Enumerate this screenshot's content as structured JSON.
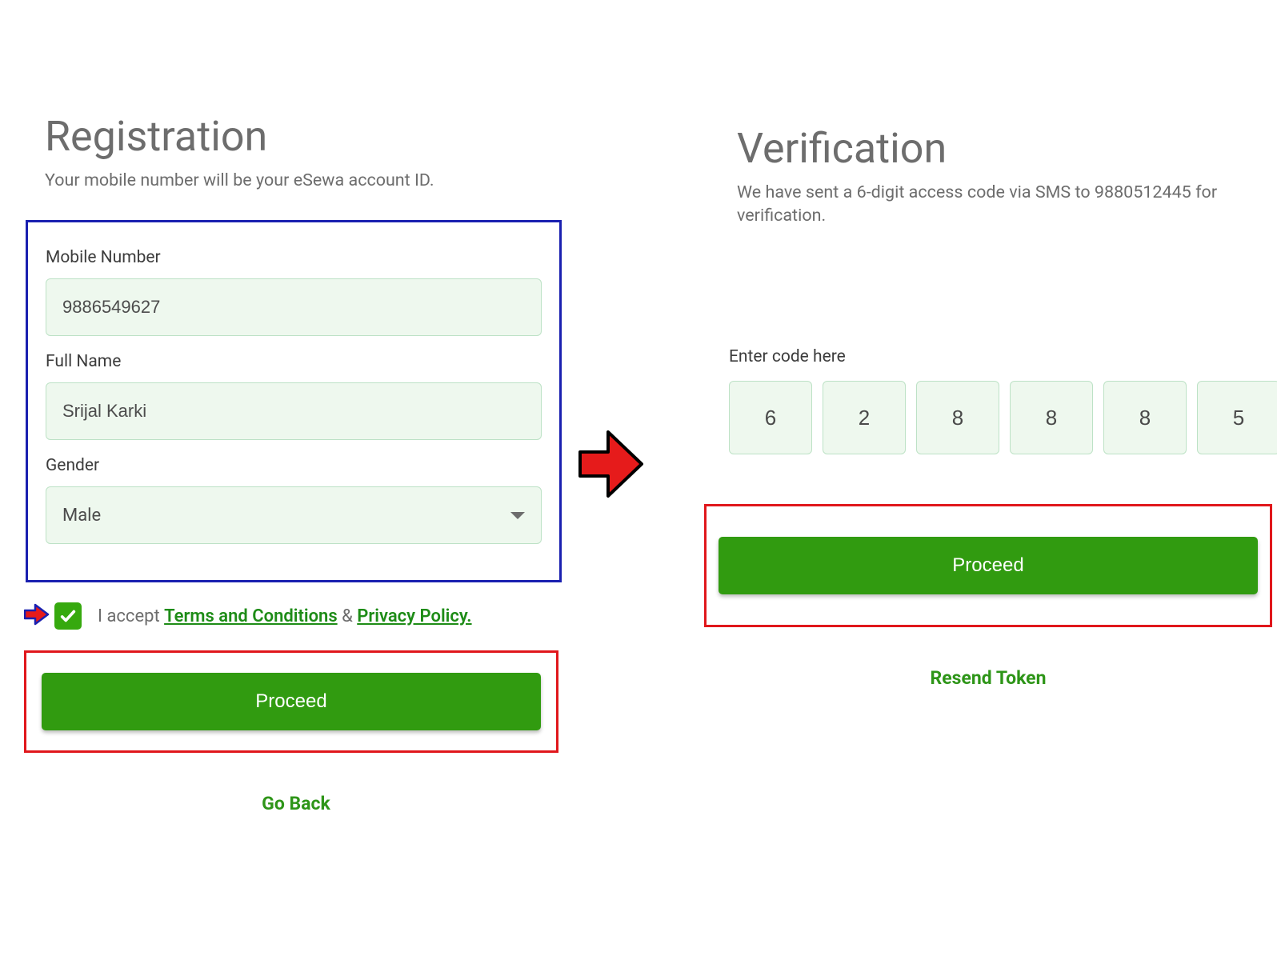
{
  "registration": {
    "title": "Registration",
    "subtitle": "Your mobile number will be your eSewa account ID.",
    "mobile_label": "Mobile Number",
    "mobile_value": "9886549627",
    "name_label": "Full Name",
    "name_value": "Srijal Karki",
    "gender_label": "Gender",
    "gender_value": "Male",
    "accept_prefix": "I accept ",
    "terms_link": "Terms and Conditions",
    "amp": " & ",
    "privacy_link": "Privacy Policy.",
    "proceed_label": "Proceed",
    "go_back_label": "Go Back"
  },
  "verification": {
    "title": "Verification",
    "subtitle": "We have sent a 6-digit access code via SMS to 9880512445 for verification.",
    "code_label": "Enter code here",
    "code": [
      "6",
      "2",
      "8",
      "8",
      "8",
      "5"
    ],
    "proceed_label": "Proceed",
    "resend_label": "Resend Token"
  }
}
